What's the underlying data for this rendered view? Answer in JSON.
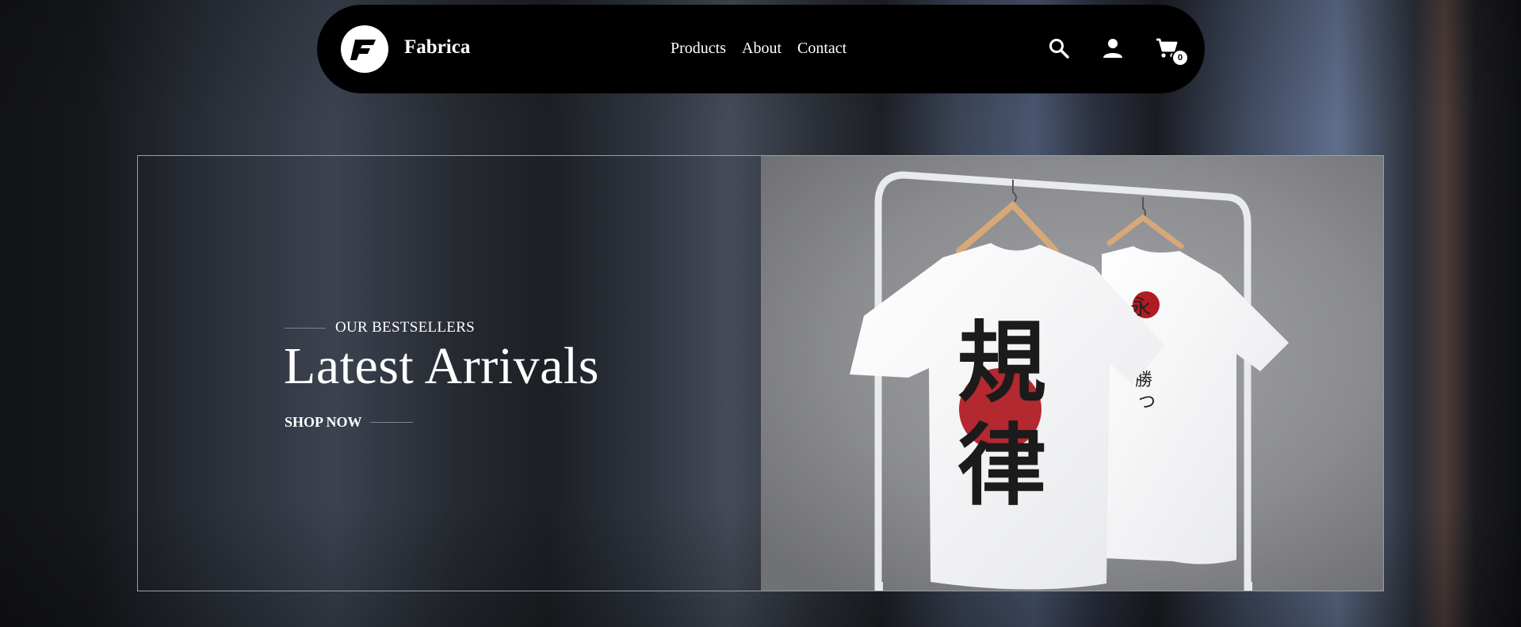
{
  "brand": {
    "name": "Fabrica",
    "logo_letter": "F"
  },
  "nav": {
    "items": [
      {
        "label": "Products"
      },
      {
        "label": "About"
      },
      {
        "label": "Contact"
      }
    ],
    "icons": [
      "search-icon",
      "user-icon",
      "cart-icon"
    ],
    "cart_count": "0"
  },
  "hero": {
    "eyebrow": "OUR BESTSELLERS",
    "title": "Latest Arrivals",
    "cta": "SHOP NOW"
  },
  "colors": {
    "nav_bg": "#000000",
    "text": "#ffffff",
    "accent_red": "#b01c24",
    "hero_border": "#9aa0ab"
  }
}
